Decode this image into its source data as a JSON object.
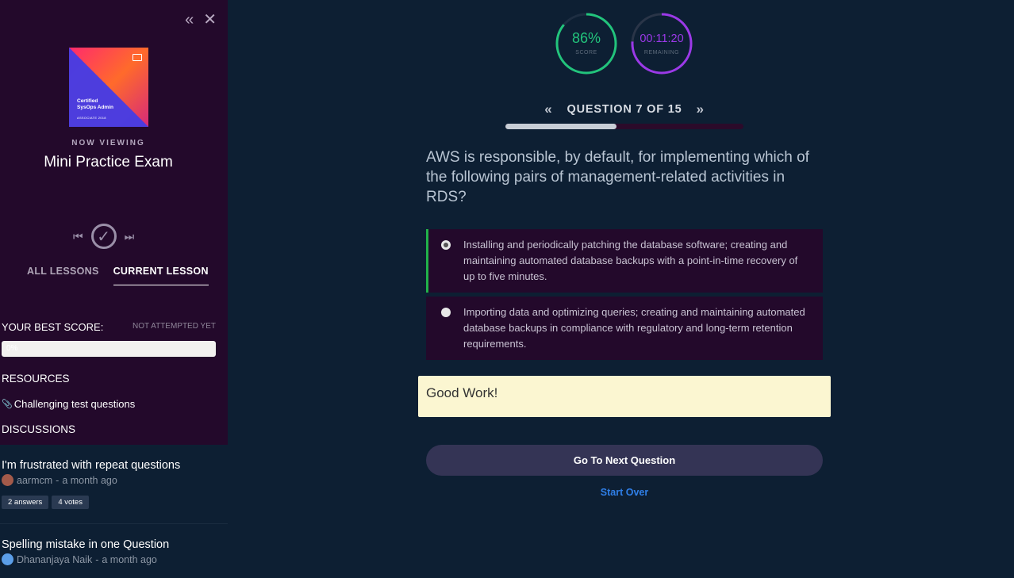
{
  "sidebar": {
    "cover": {
      "title_line1": "Certified",
      "title_line2": "SysOps Admin",
      "subtitle": "ASSOCIATE 2018"
    },
    "now_viewing_label": "NOW VIEWING",
    "lesson_title": "Mini Practice Exam",
    "tabs": [
      {
        "label": "ALL LESSONS",
        "active": false
      },
      {
        "label": "CURRENT LESSON",
        "active": true
      }
    ],
    "best_score_label": "YOUR BEST SCORE:",
    "best_score_status": "NOT ATTEMPTED YET",
    "best_score_bar_text": "0%",
    "resources_label": "RESOURCES",
    "resources": [
      {
        "label": "Challenging test questions",
        "icon": "paperclip-icon"
      }
    ],
    "discussions_label": "DISCUSSIONS",
    "discussions": [
      {
        "title": "I'm frustrated with repeat questions",
        "author": "aarmcm",
        "time": "a month ago",
        "answers": "2 answers",
        "votes": "4 votes"
      },
      {
        "title": "Spelling mistake in one Question",
        "author": "Dhananjaya Naik",
        "time": "a month ago",
        "answers": "",
        "votes": ""
      }
    ]
  },
  "stats": {
    "score_value": "86%",
    "score_label": "SCORE",
    "score_fraction": 0.86,
    "timer_value": "00:11:20",
    "timer_label": "REMAINING",
    "timer_fraction": 0.76
  },
  "question_nav": {
    "label": "QUESTION 7 OF 15",
    "progress_fraction": 0.4667
  },
  "question": {
    "text": "AWS is responsible, by default, for implementing which of the following pairs of management-related activities in RDS?",
    "options": [
      {
        "text": "Installing and periodically patching the database software; creating and maintaining automated database backups with a point-in-time recovery of up to five minutes.",
        "selected": true
      },
      {
        "text": "Importing data and optimizing queries; creating and maintaining automated database backups in compliance with regulatory and long-term retention requirements.",
        "selected": false
      }
    ]
  },
  "feedback": "Good Work!",
  "actions": {
    "next_label": "Go To Next Question",
    "start_over_label": "Start Over"
  },
  "colors": {
    "score": "#22c47c",
    "timer": "#9b39e8",
    "selected_border": "#21b24a"
  }
}
